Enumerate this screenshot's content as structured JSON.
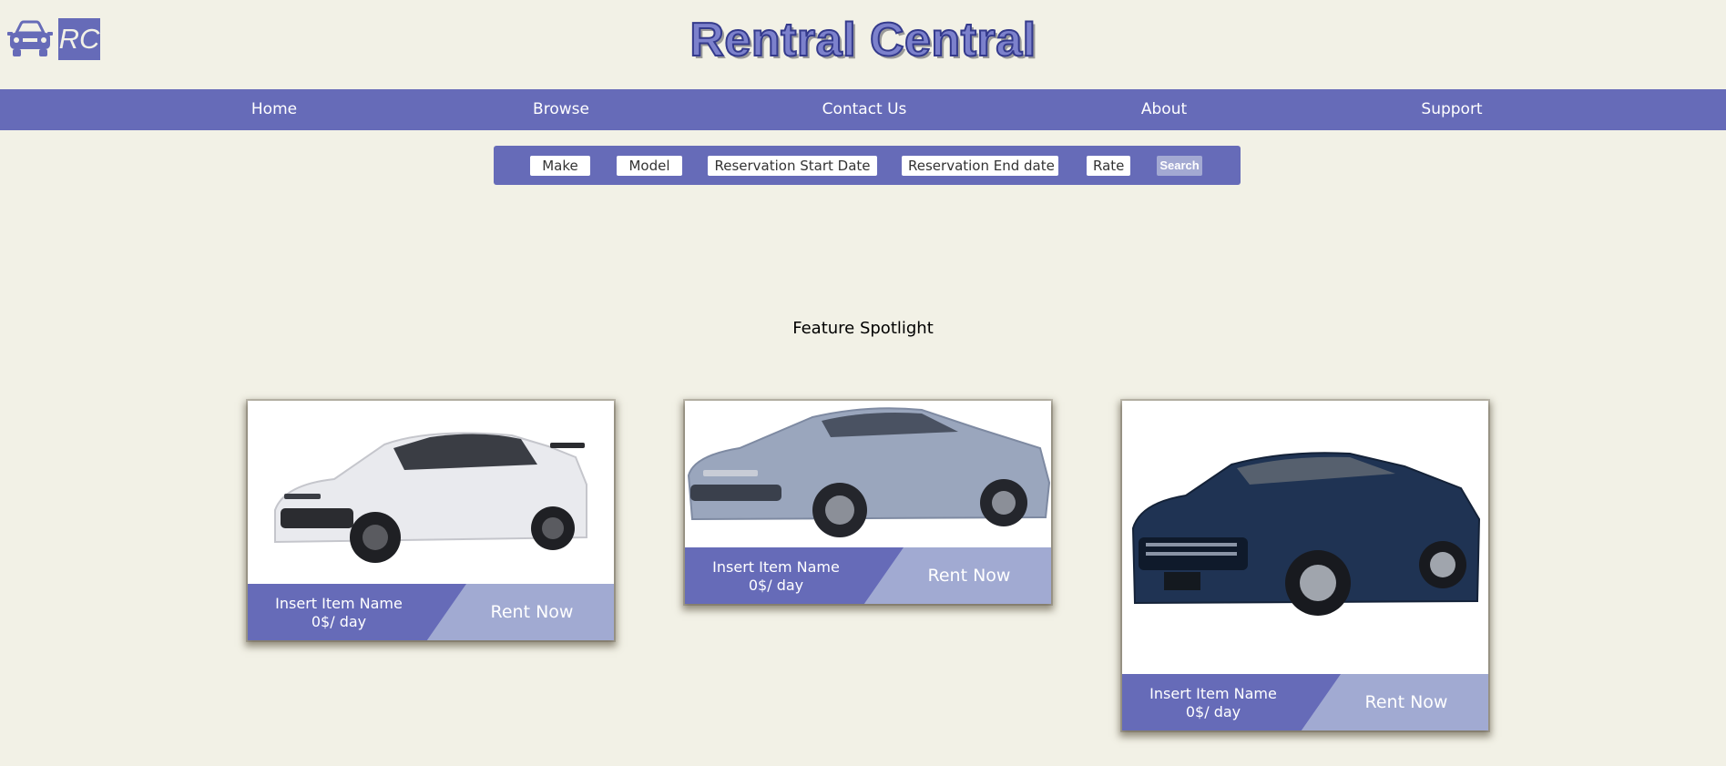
{
  "header": {
    "logo_text": "RC",
    "brand_title": "Rentral Central"
  },
  "nav": {
    "items": [
      "Home",
      "Browse",
      "Contact Us",
      "About",
      "Support"
    ]
  },
  "search": {
    "fields": [
      "Make",
      "Model",
      "Reservation Start Date",
      "Reservation End date",
      "Rate"
    ],
    "button_label": "Search"
  },
  "spotlight": {
    "title": "Feature Spotlight",
    "cards": [
      {
        "name": "Insert Item Name",
        "price": "0$/ day",
        "cta": "Rent Now",
        "car_color": "#e9eaee"
      },
      {
        "name": "Insert Item Name",
        "price": "0$/ day",
        "cta": "Rent Now",
        "car_color": "#9aa6bd"
      },
      {
        "name": "Insert Item Name",
        "price": "0$/ day",
        "cta": "Rent Now",
        "car_color": "#1f3353"
      }
    ]
  },
  "colors": {
    "background": "#f2f1e6",
    "accent": "#666bb8",
    "accent_light": "#a1aad2"
  }
}
